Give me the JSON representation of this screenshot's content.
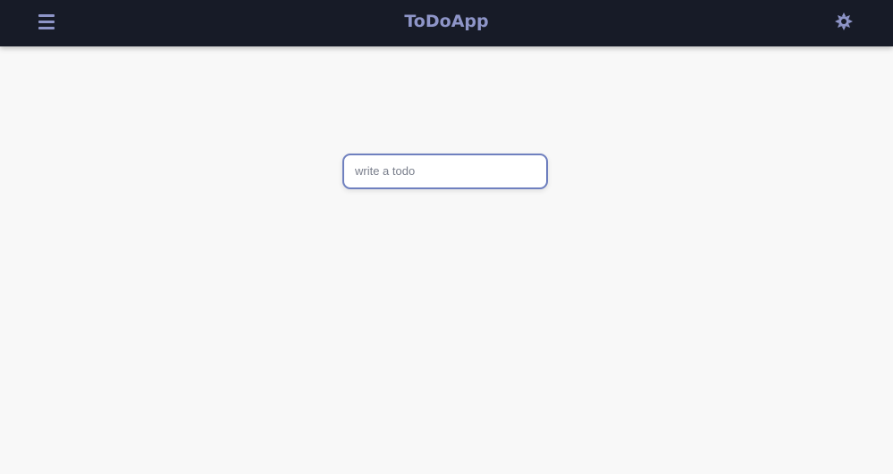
{
  "header": {
    "title": "ToDoApp",
    "menu_icon": "hamburger-menu-icon",
    "theme_icon": "sun-icon",
    "accent": "#8e95c8",
    "background": "#171b27"
  },
  "todo_input": {
    "value": "",
    "placeholder": "write a todo"
  }
}
